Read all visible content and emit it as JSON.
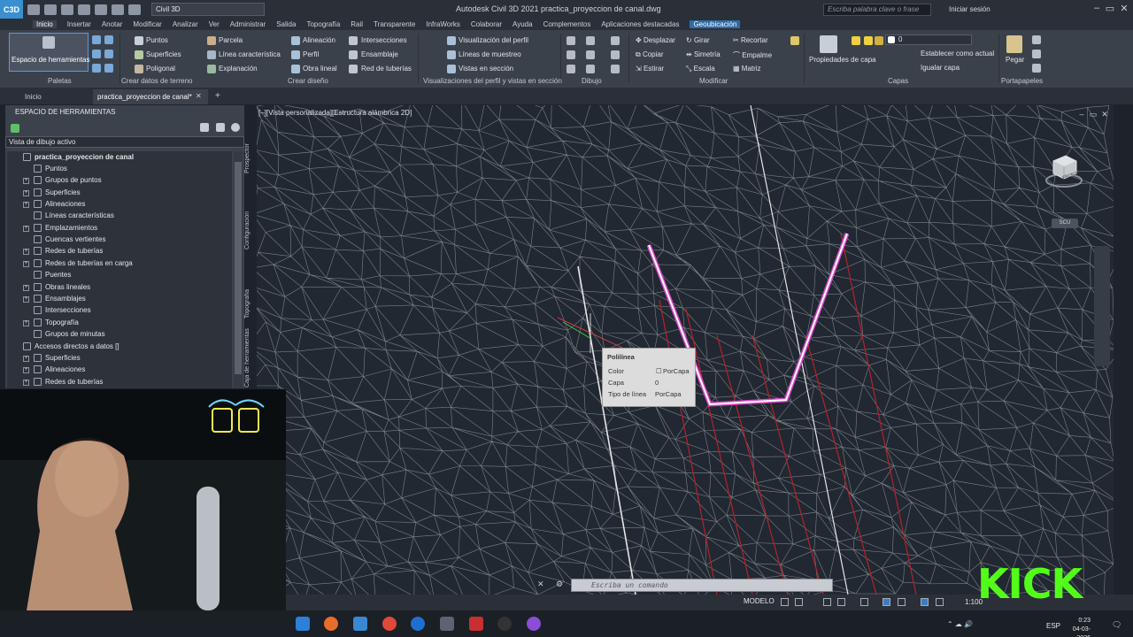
{
  "window": {
    "title": "Autodesk Civil 3D 2021    practica_proyeccion de canal.dwg",
    "app_icon": "C3D",
    "workspace": "Civil 3D",
    "search_placeholder": "Escriba palabra clave o frase",
    "signin": "Iniciar sesión"
  },
  "menu": [
    "Inicio",
    "Insertar",
    "Anotar",
    "Modificar",
    "Analizar",
    "Ver",
    "Administrar",
    "Salida",
    "Topografía",
    "Rail",
    "Transparente",
    "InfraWorks",
    "Colaborar",
    "Ayuda",
    "Complementos",
    "Aplicaciones destacadas",
    "Geoubicación"
  ],
  "ribbon": {
    "toolspace_button": "Espacio de herramientas",
    "ground_data": [
      "Puntos",
      "Superficies",
      "Poligonal"
    ],
    "design": [
      "Parcela",
      "Línea característica",
      "Explanación"
    ],
    "design2": [
      "Alineación",
      "Perfil",
      "Obra lineal"
    ],
    "design3": [
      "Intersecciones",
      "Ensamblaje",
      "Red de tuberías"
    ],
    "profile": [
      "Visualización del perfil",
      "Líneas de muestreo",
      "Vistas en sección"
    ],
    "modify": [
      "Desplazar",
      "Copiar",
      "Estirar",
      "Girar",
      "Simetría",
      "Escala",
      "Recortar",
      "Empalme",
      "Matriz"
    ],
    "layers": [
      "Propiedades de capa",
      "Establecer como actual",
      "Igualar capa"
    ],
    "layer_value": "0",
    "paste": "Pegar",
    "panels": [
      "Paletas",
      "Crear datos de terreno",
      "Crear diseño",
      "Visualizaciones del perfil y vistas en sección",
      "Dibujo",
      "Modificar",
      "Capas",
      "Portapapeles"
    ]
  },
  "doctabs": [
    "Inicio",
    "practica_proyeccion de canal*"
  ],
  "toolspace": {
    "title": "ESPACIO DE HERRAMIENTAS",
    "view": "Vista de dibujo activo",
    "root": "practica_proyeccion de canal",
    "items": [
      "Puntos",
      "Grupos de puntos",
      "Superficies",
      "Alineaciones",
      "Líneas características",
      "Emplazamientos",
      "Cuencas vertientes",
      "Redes de tuberías",
      "Redes de tuberías en carga",
      "Puentes",
      "Obras lineales",
      "Ensamblajes",
      "Intersecciones",
      "Topografía",
      "Grupos de minutas"
    ],
    "shortcuts_root": "Accesos directos a datos []",
    "shortcuts": [
      "Superficies",
      "Alineaciones",
      "Redes de tuberías"
    ],
    "side_tabs": [
      "Prospector",
      "Configuración",
      "Topografía",
      "Caja de herramientas"
    ]
  },
  "viewport": {
    "label": "[–][Vista personalizada][Estructura alámbrica 2D]",
    "viewcube_label": "SCU",
    "viewcube_face": "FRONTAL"
  },
  "tooltip": {
    "title": "Polilínea",
    "rows": [
      {
        "k": "Color",
        "v": "PorCapa"
      },
      {
        "k": "Capa",
        "v": "0"
      },
      {
        "k": "Tipo de línea",
        "v": "PorCapa"
      }
    ]
  },
  "command": {
    "placeholder": "Escriba un comando"
  },
  "status": {
    "model": "MODELO",
    "scale": "1:100"
  },
  "taskbar": {
    "lang": "ESP",
    "time": "0:23",
    "date": "04-03-2026"
  },
  "overlay": {
    "brand": "KICK",
    "brand_color": "#53fc18"
  }
}
